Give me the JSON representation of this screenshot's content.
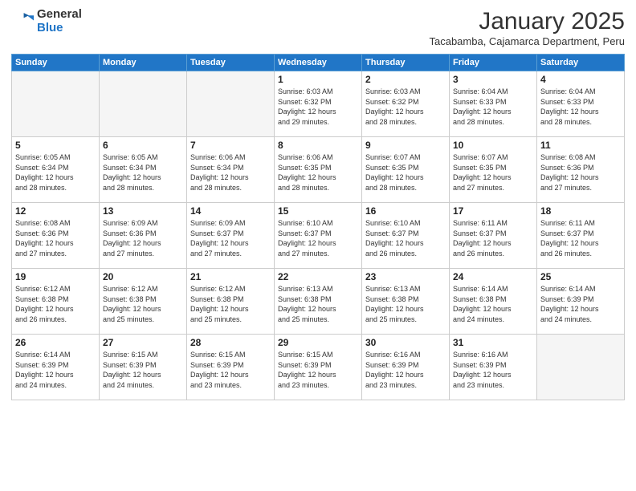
{
  "logo": {
    "general": "General",
    "blue": "Blue"
  },
  "title": "January 2025",
  "subtitle": "Tacabamba, Cajamarca Department, Peru",
  "weekdays": [
    "Sunday",
    "Monday",
    "Tuesday",
    "Wednesday",
    "Thursday",
    "Friday",
    "Saturday"
  ],
  "weeks": [
    [
      {
        "day": "",
        "info": ""
      },
      {
        "day": "",
        "info": ""
      },
      {
        "day": "",
        "info": ""
      },
      {
        "day": "1",
        "info": "Sunrise: 6:03 AM\nSunset: 6:32 PM\nDaylight: 12 hours\nand 29 minutes."
      },
      {
        "day": "2",
        "info": "Sunrise: 6:03 AM\nSunset: 6:32 PM\nDaylight: 12 hours\nand 28 minutes."
      },
      {
        "day": "3",
        "info": "Sunrise: 6:04 AM\nSunset: 6:33 PM\nDaylight: 12 hours\nand 28 minutes."
      },
      {
        "day": "4",
        "info": "Sunrise: 6:04 AM\nSunset: 6:33 PM\nDaylight: 12 hours\nand 28 minutes."
      }
    ],
    [
      {
        "day": "5",
        "info": "Sunrise: 6:05 AM\nSunset: 6:34 PM\nDaylight: 12 hours\nand 28 minutes."
      },
      {
        "day": "6",
        "info": "Sunrise: 6:05 AM\nSunset: 6:34 PM\nDaylight: 12 hours\nand 28 minutes."
      },
      {
        "day": "7",
        "info": "Sunrise: 6:06 AM\nSunset: 6:34 PM\nDaylight: 12 hours\nand 28 minutes."
      },
      {
        "day": "8",
        "info": "Sunrise: 6:06 AM\nSunset: 6:35 PM\nDaylight: 12 hours\nand 28 minutes."
      },
      {
        "day": "9",
        "info": "Sunrise: 6:07 AM\nSunset: 6:35 PM\nDaylight: 12 hours\nand 28 minutes."
      },
      {
        "day": "10",
        "info": "Sunrise: 6:07 AM\nSunset: 6:35 PM\nDaylight: 12 hours\nand 27 minutes."
      },
      {
        "day": "11",
        "info": "Sunrise: 6:08 AM\nSunset: 6:36 PM\nDaylight: 12 hours\nand 27 minutes."
      }
    ],
    [
      {
        "day": "12",
        "info": "Sunrise: 6:08 AM\nSunset: 6:36 PM\nDaylight: 12 hours\nand 27 minutes."
      },
      {
        "day": "13",
        "info": "Sunrise: 6:09 AM\nSunset: 6:36 PM\nDaylight: 12 hours\nand 27 minutes."
      },
      {
        "day": "14",
        "info": "Sunrise: 6:09 AM\nSunset: 6:37 PM\nDaylight: 12 hours\nand 27 minutes."
      },
      {
        "day": "15",
        "info": "Sunrise: 6:10 AM\nSunset: 6:37 PM\nDaylight: 12 hours\nand 27 minutes."
      },
      {
        "day": "16",
        "info": "Sunrise: 6:10 AM\nSunset: 6:37 PM\nDaylight: 12 hours\nand 26 minutes."
      },
      {
        "day": "17",
        "info": "Sunrise: 6:11 AM\nSunset: 6:37 PM\nDaylight: 12 hours\nand 26 minutes."
      },
      {
        "day": "18",
        "info": "Sunrise: 6:11 AM\nSunset: 6:37 PM\nDaylight: 12 hours\nand 26 minutes."
      }
    ],
    [
      {
        "day": "19",
        "info": "Sunrise: 6:12 AM\nSunset: 6:38 PM\nDaylight: 12 hours\nand 26 minutes."
      },
      {
        "day": "20",
        "info": "Sunrise: 6:12 AM\nSunset: 6:38 PM\nDaylight: 12 hours\nand 25 minutes."
      },
      {
        "day": "21",
        "info": "Sunrise: 6:12 AM\nSunset: 6:38 PM\nDaylight: 12 hours\nand 25 minutes."
      },
      {
        "day": "22",
        "info": "Sunrise: 6:13 AM\nSunset: 6:38 PM\nDaylight: 12 hours\nand 25 minutes."
      },
      {
        "day": "23",
        "info": "Sunrise: 6:13 AM\nSunset: 6:38 PM\nDaylight: 12 hours\nand 25 minutes."
      },
      {
        "day": "24",
        "info": "Sunrise: 6:14 AM\nSunset: 6:38 PM\nDaylight: 12 hours\nand 24 minutes."
      },
      {
        "day": "25",
        "info": "Sunrise: 6:14 AM\nSunset: 6:39 PM\nDaylight: 12 hours\nand 24 minutes."
      }
    ],
    [
      {
        "day": "26",
        "info": "Sunrise: 6:14 AM\nSunset: 6:39 PM\nDaylight: 12 hours\nand 24 minutes."
      },
      {
        "day": "27",
        "info": "Sunrise: 6:15 AM\nSunset: 6:39 PM\nDaylight: 12 hours\nand 24 minutes."
      },
      {
        "day": "28",
        "info": "Sunrise: 6:15 AM\nSunset: 6:39 PM\nDaylight: 12 hours\nand 23 minutes."
      },
      {
        "day": "29",
        "info": "Sunrise: 6:15 AM\nSunset: 6:39 PM\nDaylight: 12 hours\nand 23 minutes."
      },
      {
        "day": "30",
        "info": "Sunrise: 6:16 AM\nSunset: 6:39 PM\nDaylight: 12 hours\nand 23 minutes."
      },
      {
        "day": "31",
        "info": "Sunrise: 6:16 AM\nSunset: 6:39 PM\nDaylight: 12 hours\nand 23 minutes."
      },
      {
        "day": "",
        "info": ""
      }
    ]
  ]
}
